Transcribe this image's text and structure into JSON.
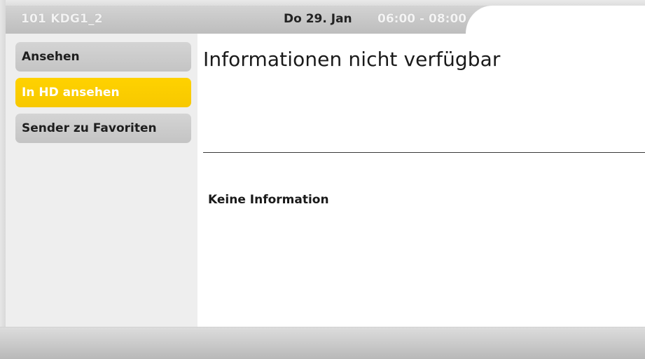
{
  "header": {
    "channel": "101  KDG1_2",
    "date": "Do 29. Jan",
    "time_range": "06:00 - 08:00"
  },
  "menu": {
    "items": [
      {
        "label": "Ansehen",
        "selected": false
      },
      {
        "label": "In HD ansehen",
        "selected": true
      },
      {
        "label": "Sender zu Favoriten",
        "selected": false
      }
    ]
  },
  "content": {
    "title": "Informationen nicht verfügbar",
    "info": "Keine Information"
  },
  "colors": {
    "selection": "#ffd200",
    "menu_item": "#cccccc",
    "header": "#c8c8c8"
  }
}
